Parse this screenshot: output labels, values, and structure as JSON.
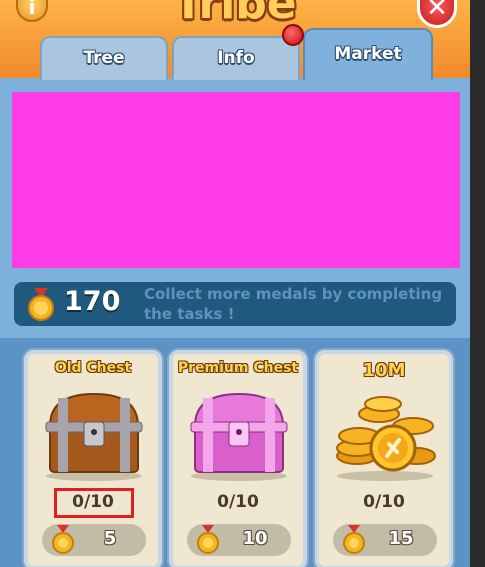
{
  "header": {
    "title": "Tribe",
    "info_glyph": "i",
    "close_glyph": "✕"
  },
  "tabs": [
    {
      "label": "Tree"
    },
    {
      "label": "Info"
    },
    {
      "label": "Market"
    }
  ],
  "medals": {
    "count": "170",
    "message": "Collect more medals by completing the tasks !"
  },
  "cards": [
    {
      "title": "Old Chest",
      "progress": "0/10",
      "price": "5",
      "icon": "old-chest-icon"
    },
    {
      "title": "Premium Chest",
      "progress": "0/10",
      "price": "10",
      "icon": "premium-chest-icon"
    },
    {
      "title": "10M",
      "progress": "0/10",
      "price": "15",
      "icon": "coin-pile-icon"
    }
  ],
  "colors": {
    "header": "#f08a2a",
    "panel": "#7eb0dc",
    "banner": "#ff3ce8",
    "medal_bar": "#1f5a7e",
    "card": "#efe7cf",
    "highlight": "#e02020"
  }
}
